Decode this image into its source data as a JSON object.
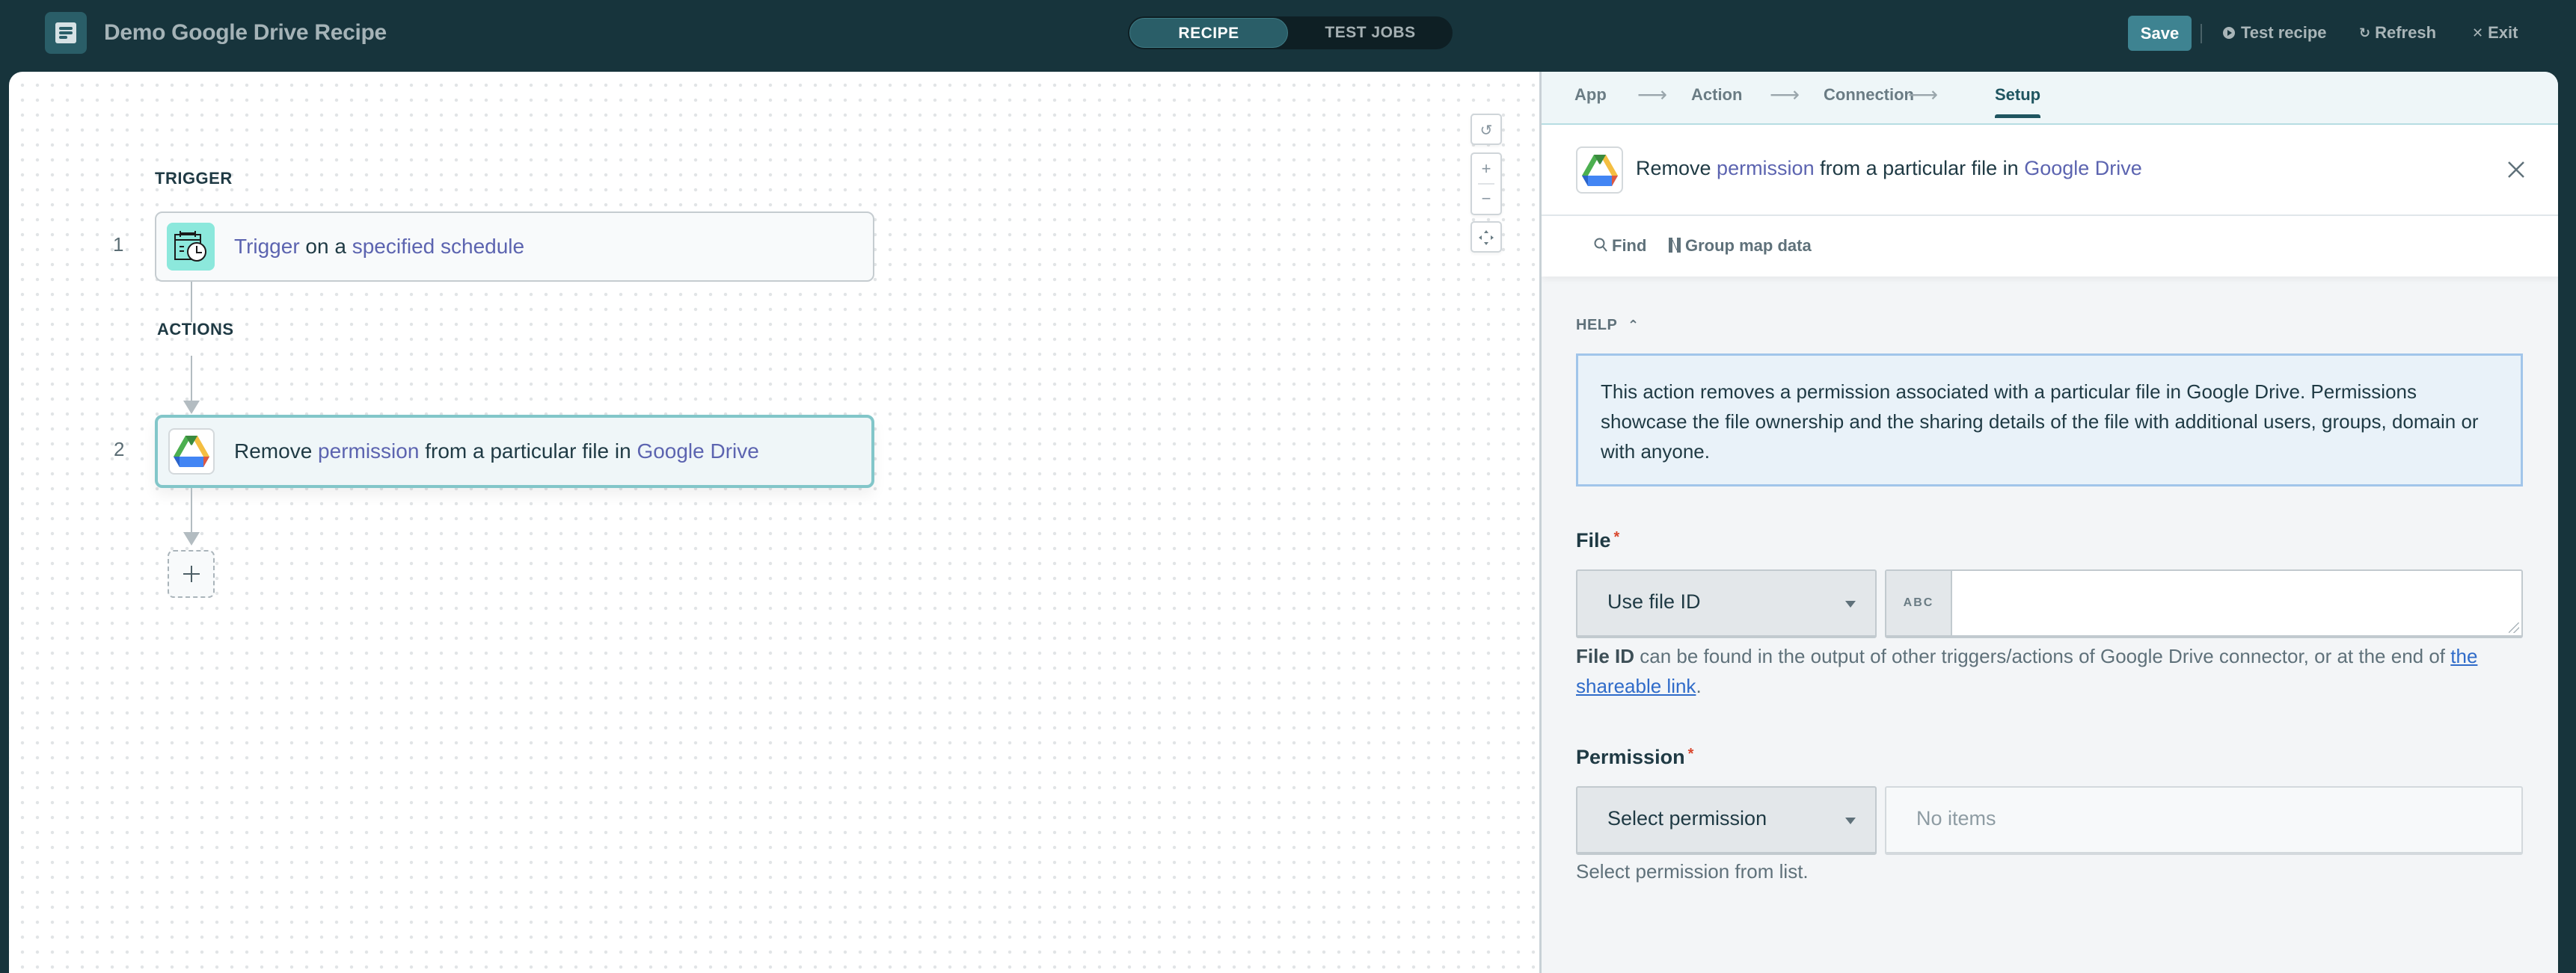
{
  "header": {
    "app_icon": "document-list-icon",
    "title": "Demo Google Drive Recipe",
    "mode_tabs": [
      {
        "label": "RECIPE",
        "active": true
      },
      {
        "label": "TEST JOBS",
        "active": false
      }
    ],
    "save_label": "Save",
    "actions": [
      {
        "label": "Test recipe",
        "icon": "play-circle-icon"
      },
      {
        "label": "Refresh",
        "icon": "refresh-icon"
      },
      {
        "label": "Exit",
        "icon": "close-icon"
      }
    ]
  },
  "canvas": {
    "trigger_section_label": "TRIGGER",
    "actions_section_label": "ACTIONS",
    "steps": [
      {
        "number": "1",
        "icon": "schedule-calendar-clock-icon",
        "parts": [
          {
            "text": "Trigger",
            "link": true
          },
          {
            "text": " on a ",
            "link": false
          },
          {
            "text": "specified schedule",
            "link": true
          }
        ]
      },
      {
        "number": "2",
        "icon": "google-drive-icon",
        "parts": [
          {
            "text": "Remove ",
            "link": false
          },
          {
            "text": "permission",
            "link": true
          },
          {
            "text": " from a particular file in ",
            "link": false
          },
          {
            "text": "Google Drive",
            "link": true
          }
        ]
      }
    ],
    "controls": [
      "reset-icon",
      "zoom-in-icon",
      "zoom-out-icon",
      "fit-to-screen-icon"
    ]
  },
  "panel": {
    "stepper": [
      {
        "label": "App",
        "active": false
      },
      {
        "label": "Action",
        "active": false
      },
      {
        "label": "Connection",
        "active": false
      },
      {
        "label": "Setup",
        "active": true
      }
    ],
    "title_parts": [
      {
        "text": "Remove ",
        "link": false
      },
      {
        "text": "permission",
        "link": true
      },
      {
        "text": " from a particular file in ",
        "link": false
      },
      {
        "text": "Google Drive",
        "link": true
      }
    ],
    "toolbar": {
      "find_label": "Find",
      "group_map_label": "Group map data"
    },
    "help": {
      "label": "HELP",
      "text": "This action removes a permission associated with a particular file in Google Drive. Permissions showcase the file ownership and the sharing details of the file with additional users, groups, domain or with anyone."
    },
    "fields": {
      "file": {
        "label": "File",
        "required_mark": "*",
        "mode_selected": "Use file ID",
        "type_tag": "ABC",
        "value": "",
        "hint_bold": "File ID",
        "hint_text": " can be found in the output of other triggers/actions of Google Drive connector, or at the end of ",
        "hint_link": "the shareable link",
        "hint_end": "."
      },
      "permission": {
        "label": "Permission",
        "required_mark": "*",
        "mode_selected": "Select permission",
        "placeholder": "No items",
        "hint": "Select permission from list."
      }
    }
  },
  "colors": {
    "header_bg": "#17343c",
    "accent_teal": "#3e8391",
    "link_purple": "#5c64b0",
    "selected_step_border": "#82c6c9",
    "help_border": "#a1c5ea",
    "required": "#d9472e",
    "link_blue": "#2f6bc9"
  }
}
